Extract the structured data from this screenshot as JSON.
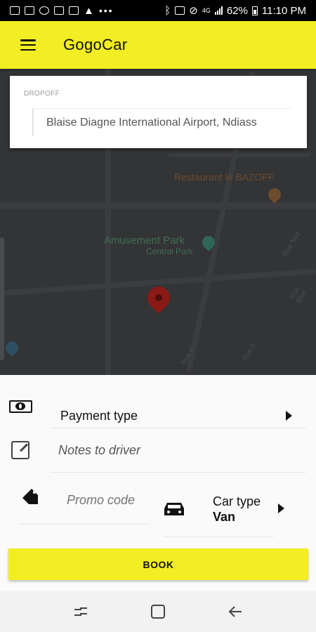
{
  "status_bar": {
    "battery": "62%",
    "time": "11:10 PM",
    "network": "4G"
  },
  "app_bar": {
    "title": "GogoCar"
  },
  "map": {
    "poi_restaurant": "Restaurant le BAZOFF",
    "poi_park": "Amusement Park",
    "poi_park_sub": "Central Park",
    "streets": [
      "Rue 8",
      "Rue 4",
      "Rue Naz",
      "Rue Blair"
    ]
  },
  "dropoff": {
    "label": "DROPOFF",
    "value": "Blaise Diagne International Airport, Ndiass"
  },
  "payment": {
    "label": "Payment type"
  },
  "notes": {
    "placeholder": "Notes to driver"
  },
  "promo": {
    "placeholder": "Promo code"
  },
  "car_type": {
    "label": "Car type",
    "value": "Van"
  },
  "book_button": {
    "label": "BOOK"
  },
  "colors": {
    "accent": "#f2ee23",
    "map_background": "#333436",
    "marker": "#8a1a16"
  }
}
